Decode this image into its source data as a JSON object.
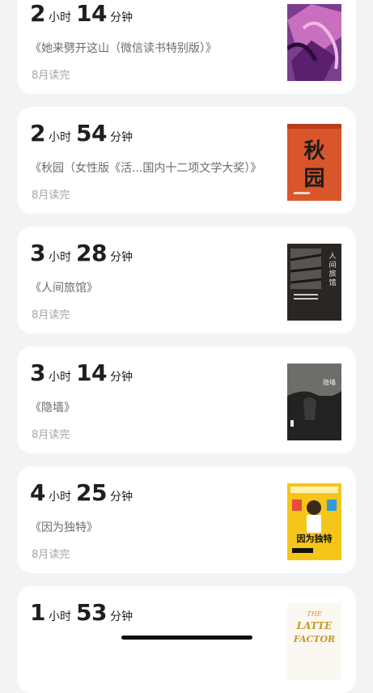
{
  "records": [
    {
      "hours": "2",
      "hour_unit": "小时",
      "minutes": "14",
      "minute_unit": "分钟",
      "title": "《她来劈开这山（微信读书特别版）》",
      "date": "8月读完",
      "cover": "cover-purple-illustration"
    },
    {
      "hours": "2",
      "hour_unit": "小时",
      "minutes": "54",
      "minute_unit": "分钟",
      "title": "《秋园（女性版《活...国内十二项文学大奖）》",
      "date": "8月读完",
      "cover": "cover-qiuyuan",
      "cover_text": "秋园"
    },
    {
      "hours": "3",
      "hour_unit": "小时",
      "minutes": "28",
      "minute_unit": "分钟",
      "title": "《人间旅馆》",
      "date": "8月读完",
      "cover": "cover-renjian-lvguan",
      "cover_text": "人间旅馆"
    },
    {
      "hours": "3",
      "hour_unit": "小时",
      "minutes": "14",
      "minute_unit": "分钟",
      "title": "《隐墙》",
      "date": "8月读完",
      "cover": "cover-yinqiang",
      "cover_text": "隐墙"
    },
    {
      "hours": "4",
      "hour_unit": "小时",
      "minutes": "25",
      "minute_unit": "分钟",
      "title": "《因为独特》",
      "date": "8月读完",
      "cover": "cover-yinwei-dute",
      "cover_text": "因为独特"
    },
    {
      "hours": "1",
      "hour_unit": "小时",
      "minutes": "53",
      "minute_unit": "分钟",
      "title": "",
      "date": "",
      "cover": "cover-latte-factor",
      "cover_text": "THE LATTE FACTOR"
    }
  ]
}
